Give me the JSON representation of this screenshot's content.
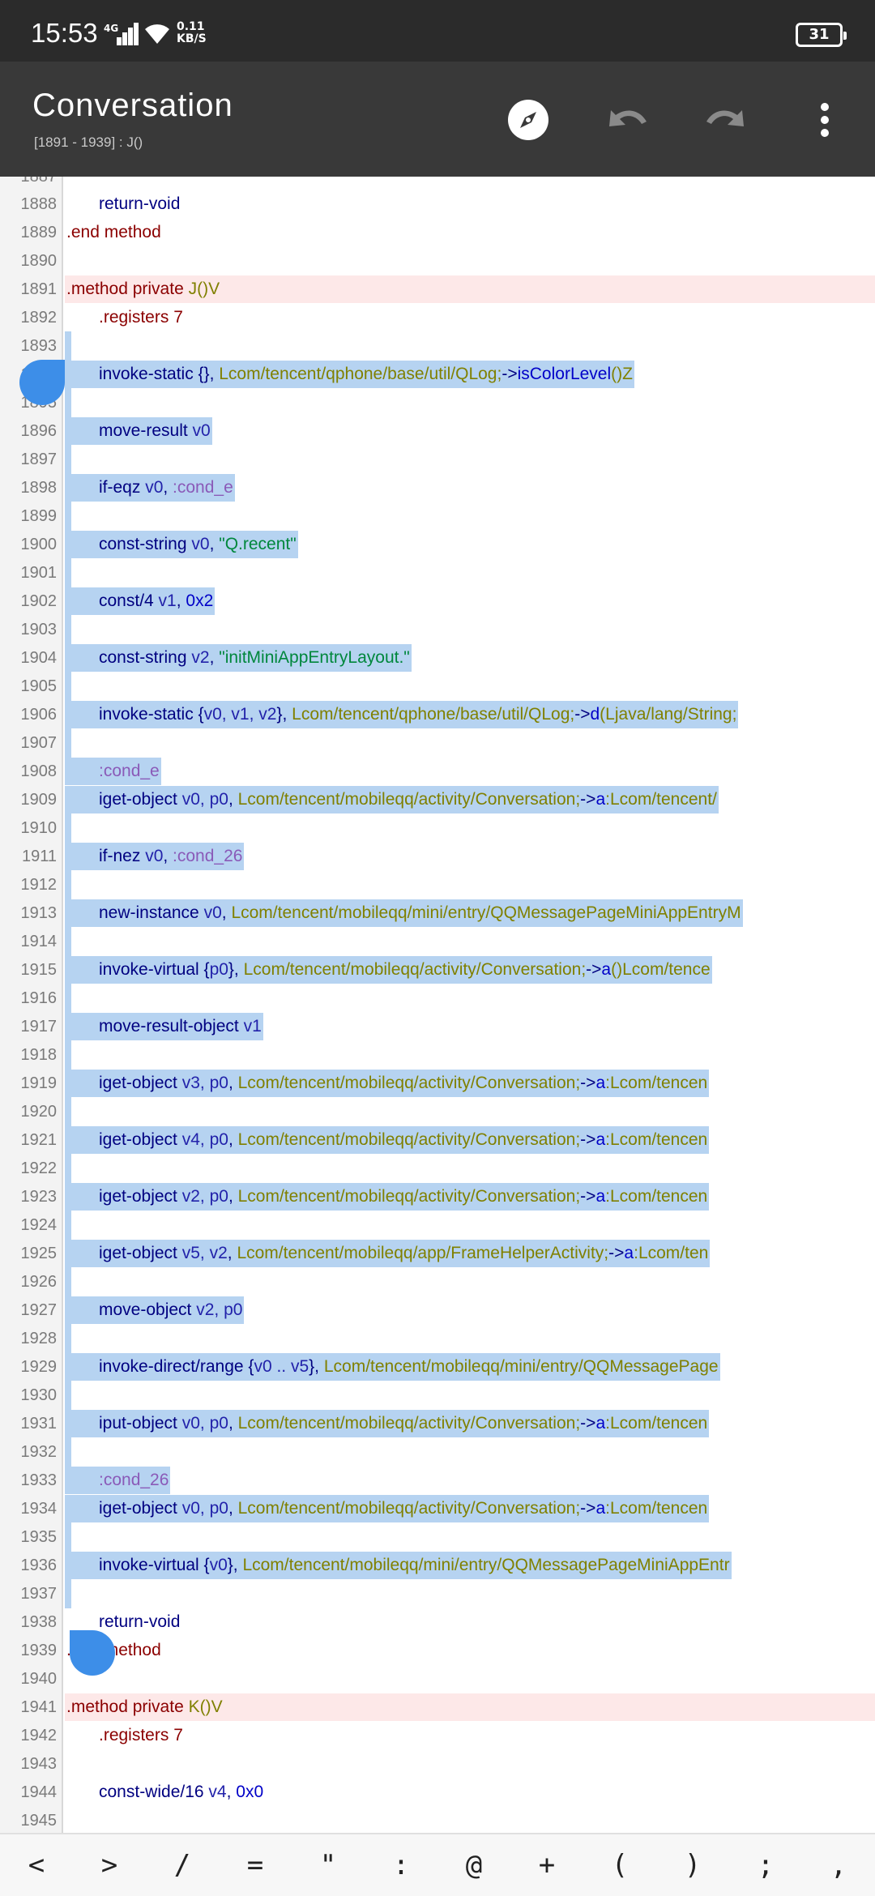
{
  "status_bar": {
    "time": "15:53",
    "network": "4G",
    "speed_value": "0.11",
    "speed_unit": "KB/S",
    "battery": "31"
  },
  "app_bar": {
    "title": "Conversation",
    "subtitle": "[1891 - 1939] : J()",
    "icons": [
      "compass-icon",
      "undo-icon",
      "redo-icon",
      "more-vert-icon"
    ]
  },
  "editor": {
    "top_partial_line": "1887",
    "lines": [
      {
        "n": "1888",
        "i": 1,
        "c": [
          [
            "k-op",
            "return-void"
          ]
        ]
      },
      {
        "n": "1889",
        "i": 0,
        "c": [
          [
            "k-dir",
            ".end method"
          ]
        ]
      },
      {
        "n": "1890",
        "i": 0,
        "c": []
      },
      {
        "n": "1891",
        "i": 0,
        "m": true,
        "c": [
          [
            "k-dir",
            ".method private "
          ],
          [
            "k-type",
            "J()V"
          ]
        ]
      },
      {
        "n": "1892",
        "i": 1,
        "c": [
          [
            "k-dir",
            ".registers 7"
          ]
        ]
      },
      {
        "n": "1893",
        "i": 0,
        "s": true,
        "c": []
      },
      {
        "n": "1894",
        "i": 1,
        "s": true,
        "c": [
          [
            "k-op",
            "invoke-static {}, "
          ],
          [
            "k-type",
            "Lcom/tencent/qphone/base/util/QLog;"
          ],
          [
            "k-op",
            "->"
          ],
          [
            "k-meth",
            "isColorLevel"
          ],
          [
            "k-type",
            "()Z"
          ]
        ]
      },
      {
        "n": "1895",
        "i": 0,
        "s": true,
        "c": []
      },
      {
        "n": "1896",
        "i": 1,
        "s": true,
        "c": [
          [
            "k-op",
            "move-result "
          ],
          [
            "k-reg",
            "v0"
          ]
        ]
      },
      {
        "n": "1897",
        "i": 0,
        "s": true,
        "c": []
      },
      {
        "n": "1898",
        "i": 1,
        "s": true,
        "c": [
          [
            "k-op",
            "if-eqz "
          ],
          [
            "k-reg",
            "v0"
          ],
          [
            "k-op",
            ", "
          ],
          [
            "k-label",
            ":cond_e"
          ]
        ]
      },
      {
        "n": "1899",
        "i": 0,
        "s": true,
        "c": []
      },
      {
        "n": "1900",
        "i": 1,
        "s": true,
        "c": [
          [
            "k-op",
            "const-string "
          ],
          [
            "k-reg",
            "v0"
          ],
          [
            "k-op",
            ", "
          ],
          [
            "k-str",
            "\"Q.recent\""
          ]
        ]
      },
      {
        "n": "1901",
        "i": 0,
        "s": true,
        "c": []
      },
      {
        "n": "1902",
        "i": 1,
        "s": true,
        "c": [
          [
            "k-op",
            "const/4 "
          ],
          [
            "k-reg",
            "v1"
          ],
          [
            "k-op",
            ", "
          ],
          [
            "k-hex",
            "0x2"
          ]
        ]
      },
      {
        "n": "1903",
        "i": 0,
        "s": true,
        "c": []
      },
      {
        "n": "1904",
        "i": 1,
        "s": true,
        "c": [
          [
            "k-op",
            "const-string "
          ],
          [
            "k-reg",
            "v2"
          ],
          [
            "k-op",
            ", "
          ],
          [
            "k-str",
            "\"initMiniAppEntryLayout.\""
          ]
        ]
      },
      {
        "n": "1905",
        "i": 0,
        "s": true,
        "c": []
      },
      {
        "n": "1906",
        "i": 1,
        "s": true,
        "c": [
          [
            "k-op",
            "invoke-static {"
          ],
          [
            "k-reg",
            "v0, v1, v2"
          ],
          [
            "k-op",
            "}, "
          ],
          [
            "k-type",
            "Lcom/tencent/qphone/base/util/QLog;"
          ],
          [
            "k-op",
            "->"
          ],
          [
            "k-meth",
            "d"
          ],
          [
            "k-type",
            "(Ljava/lang/String;"
          ]
        ]
      },
      {
        "n": "1907",
        "i": 0,
        "s": true,
        "c": []
      },
      {
        "n": "1908",
        "i": 1,
        "s": true,
        "c": [
          [
            "k-label",
            ":cond_e"
          ]
        ]
      },
      {
        "n": "1909",
        "i": 1,
        "s": true,
        "c": [
          [
            "k-op",
            "iget-object "
          ],
          [
            "k-reg",
            "v0, p0"
          ],
          [
            "k-op",
            ", "
          ],
          [
            "k-type",
            "Lcom/tencent/mobileqq/activity/Conversation;"
          ],
          [
            "k-op",
            "->"
          ],
          [
            "k-meth",
            "a"
          ],
          [
            "k-type",
            ":Lcom/tencent/"
          ]
        ]
      },
      {
        "n": "1910",
        "i": 0,
        "s": true,
        "c": []
      },
      {
        "n": "1911",
        "i": 1,
        "s": true,
        "c": [
          [
            "k-op",
            "if-nez "
          ],
          [
            "k-reg",
            "v0"
          ],
          [
            "k-op",
            ", "
          ],
          [
            "k-label",
            ":cond_26"
          ]
        ]
      },
      {
        "n": "1912",
        "i": 0,
        "s": true,
        "c": []
      },
      {
        "n": "1913",
        "i": 1,
        "s": true,
        "c": [
          [
            "k-op",
            "new-instance "
          ],
          [
            "k-reg",
            "v0"
          ],
          [
            "k-op",
            ", "
          ],
          [
            "k-type",
            "Lcom/tencent/mobileqq/mini/entry/QQMessagePageMiniAppEntryM"
          ]
        ]
      },
      {
        "n": "1914",
        "i": 0,
        "s": true,
        "c": []
      },
      {
        "n": "1915",
        "i": 1,
        "s": true,
        "c": [
          [
            "k-op",
            "invoke-virtual {"
          ],
          [
            "k-reg",
            "p0"
          ],
          [
            "k-op",
            "}, "
          ],
          [
            "k-type",
            "Lcom/tencent/mobileqq/activity/Conversation;"
          ],
          [
            "k-op",
            "->"
          ],
          [
            "k-meth",
            "a"
          ],
          [
            "k-type",
            "()Lcom/tence"
          ]
        ]
      },
      {
        "n": "1916",
        "i": 0,
        "s": true,
        "c": []
      },
      {
        "n": "1917",
        "i": 1,
        "s": true,
        "c": [
          [
            "k-op",
            "move-result-object "
          ],
          [
            "k-reg",
            "v1"
          ]
        ]
      },
      {
        "n": "1918",
        "i": 0,
        "s": true,
        "c": []
      },
      {
        "n": "1919",
        "i": 1,
        "s": true,
        "c": [
          [
            "k-op",
            "iget-object "
          ],
          [
            "k-reg",
            "v3, p0"
          ],
          [
            "k-op",
            ", "
          ],
          [
            "k-type",
            "Lcom/tencent/mobileqq/activity/Conversation;"
          ],
          [
            "k-op",
            "->"
          ],
          [
            "k-meth",
            "a"
          ],
          [
            "k-type",
            ":Lcom/tencen"
          ]
        ]
      },
      {
        "n": "1920",
        "i": 0,
        "s": true,
        "c": []
      },
      {
        "n": "1921",
        "i": 1,
        "s": true,
        "c": [
          [
            "k-op",
            "iget-object "
          ],
          [
            "k-reg",
            "v4, p0"
          ],
          [
            "k-op",
            ", "
          ],
          [
            "k-type",
            "Lcom/tencent/mobileqq/activity/Conversation;"
          ],
          [
            "k-op",
            "->"
          ],
          [
            "k-meth",
            "a"
          ],
          [
            "k-type",
            ":Lcom/tencen"
          ]
        ]
      },
      {
        "n": "1922",
        "i": 0,
        "s": true,
        "c": []
      },
      {
        "n": "1923",
        "i": 1,
        "s": true,
        "c": [
          [
            "k-op",
            "iget-object "
          ],
          [
            "k-reg",
            "v2, p0"
          ],
          [
            "k-op",
            ", "
          ],
          [
            "k-type",
            "Lcom/tencent/mobileqq/activity/Conversation;"
          ],
          [
            "k-op",
            "->"
          ],
          [
            "k-meth",
            "a"
          ],
          [
            "k-type",
            ":Lcom/tencen"
          ]
        ]
      },
      {
        "n": "1924",
        "i": 0,
        "s": true,
        "c": []
      },
      {
        "n": "1925",
        "i": 1,
        "s": true,
        "c": [
          [
            "k-op",
            "iget-object "
          ],
          [
            "k-reg",
            "v5, v2"
          ],
          [
            "k-op",
            ", "
          ],
          [
            "k-type",
            "Lcom/tencent/mobileqq/app/FrameHelperActivity;"
          ],
          [
            "k-op",
            "->"
          ],
          [
            "k-meth",
            "a"
          ],
          [
            "k-type",
            ":Lcom/ten"
          ]
        ]
      },
      {
        "n": "1926",
        "i": 0,
        "s": true,
        "c": []
      },
      {
        "n": "1927",
        "i": 1,
        "s": true,
        "c": [
          [
            "k-op",
            "move-object "
          ],
          [
            "k-reg",
            "v2, p0"
          ]
        ]
      },
      {
        "n": "1928",
        "i": 0,
        "s": true,
        "c": []
      },
      {
        "n": "1929",
        "i": 1,
        "s": true,
        "c": [
          [
            "k-op",
            "invoke-direct/range {"
          ],
          [
            "k-reg",
            "v0 .. v5"
          ],
          [
            "k-op",
            "}, "
          ],
          [
            "k-type",
            "Lcom/tencent/mobileqq/mini/entry/QQMessagePage"
          ]
        ]
      },
      {
        "n": "1930",
        "i": 0,
        "s": true,
        "c": []
      },
      {
        "n": "1931",
        "i": 1,
        "s": true,
        "c": [
          [
            "k-op",
            "iput-object "
          ],
          [
            "k-reg",
            "v0, p0"
          ],
          [
            "k-op",
            ", "
          ],
          [
            "k-type",
            "Lcom/tencent/mobileqq/activity/Conversation;"
          ],
          [
            "k-op",
            "->"
          ],
          [
            "k-meth",
            "a"
          ],
          [
            "k-type",
            ":Lcom/tencen"
          ]
        ]
      },
      {
        "n": "1932",
        "i": 0,
        "s": true,
        "c": []
      },
      {
        "n": "1933",
        "i": 1,
        "s": true,
        "c": [
          [
            "k-label",
            ":cond_26"
          ]
        ]
      },
      {
        "n": "1934",
        "i": 1,
        "s": true,
        "c": [
          [
            "k-op",
            "iget-object "
          ],
          [
            "k-reg",
            "v0, p0"
          ],
          [
            "k-op",
            ", "
          ],
          [
            "k-type",
            "Lcom/tencent/mobileqq/activity/Conversation;"
          ],
          [
            "k-op",
            "->"
          ],
          [
            "k-meth",
            "a"
          ],
          [
            "k-type",
            ":Lcom/tencen"
          ]
        ]
      },
      {
        "n": "1935",
        "i": 0,
        "s": true,
        "c": []
      },
      {
        "n": "1936",
        "i": 1,
        "s": true,
        "c": [
          [
            "k-op",
            "invoke-virtual {"
          ],
          [
            "k-reg",
            "v0"
          ],
          [
            "k-op",
            "}, "
          ],
          [
            "k-type",
            "Lcom/tencent/mobileqq/mini/entry/QQMessagePageMiniAppEntr"
          ]
        ]
      },
      {
        "n": "1937",
        "i": 0,
        "s": true,
        "c": []
      },
      {
        "n": "1938",
        "i": 1,
        "c": [
          [
            "k-op",
            "return-void"
          ]
        ]
      },
      {
        "n": "1939",
        "i": 0,
        "c": [
          [
            "k-dir",
            ".end method"
          ]
        ]
      },
      {
        "n": "1940",
        "i": 0,
        "c": []
      },
      {
        "n": "1941",
        "i": 0,
        "m": true,
        "c": [
          [
            "k-dir",
            ".method private "
          ],
          [
            "k-type",
            "K()V"
          ]
        ]
      },
      {
        "n": "1942",
        "i": 1,
        "c": [
          [
            "k-dir",
            ".registers 7"
          ]
        ]
      },
      {
        "n": "1943",
        "i": 0,
        "c": []
      },
      {
        "n": "1944",
        "i": 1,
        "c": [
          [
            "k-op",
            "const-wide/16 "
          ],
          [
            "k-reg",
            "v4"
          ],
          [
            "k-op",
            ", "
          ],
          [
            "k-hex",
            "0x0"
          ]
        ]
      },
      {
        "n": "1945",
        "i": 0,
        "c": []
      }
    ]
  },
  "symbol_bar": [
    "<",
    ">",
    "/",
    "=",
    "\"",
    ":",
    "@",
    "+",
    "(",
    ")",
    ";",
    ","
  ]
}
